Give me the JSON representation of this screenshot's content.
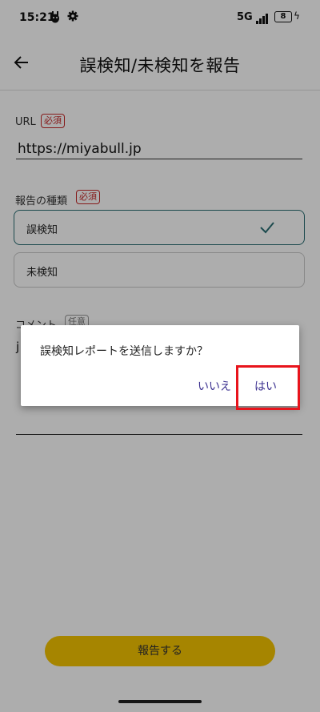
{
  "status_bar": {
    "time": "15:21",
    "network": "5G",
    "battery": "8"
  },
  "header": {
    "title": "誤検知/未検知を報告"
  },
  "form": {
    "url_label": "URL",
    "required_badge": "必須",
    "url_value": "https://miyabull.jp",
    "type_label": "報告の種類",
    "type_required_badge": "必須",
    "type_options": [
      {
        "label": "誤検知",
        "selected": true
      },
      {
        "label": "未検知",
        "selected": false
      }
    ],
    "comment_label": "コメント",
    "comment_badge": "任意",
    "comment_value": "j"
  },
  "dialog": {
    "message": "誤検知レポートを送信しますか？",
    "cancel_label": "いいえ",
    "confirm_label": "はい"
  },
  "submit_label": "報告する",
  "colors": {
    "accent": "#2a6e73",
    "required": "#c62828",
    "submit": "#f5c400",
    "dialog_button": "#3a2f8f",
    "highlight": "#e8141c"
  }
}
